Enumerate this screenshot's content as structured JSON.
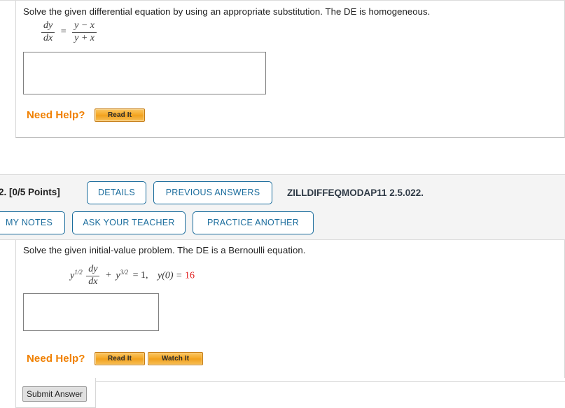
{
  "problem_1": {
    "prompt": "Solve the given differential equation by using an appropriate substitution. The DE is homogeneous.",
    "equation": {
      "lhs_num": "dy",
      "lhs_den": "dx",
      "equals": "=",
      "rhs_num": "y − x",
      "rhs_den": "y + x"
    },
    "answer_value": "",
    "need_help_label": "Need Help?",
    "read_it_label": "Read It"
  },
  "problem_2": {
    "number": "2.  [0/5 Points]",
    "assignment_code": "ZILLDIFFEQMODAP11 2.5.022.",
    "buttons": [
      {
        "id": "details",
        "label": "DETAILS"
      },
      {
        "id": "previous-answers",
        "label": "PREVIOUS ANSWERS"
      },
      {
        "id": "my-notes",
        "label": "MY NOTES"
      },
      {
        "id": "ask-your-teacher",
        "label": "ASK YOUR TEACHER"
      },
      {
        "id": "practice-another",
        "label": "PRACTICE ANOTHER"
      }
    ],
    "prompt": "Solve the given initial-value problem. The DE is a Bernoulli equation.",
    "equation": {
      "y1": "y",
      "exp1": "1/2",
      "frac_num": "dy",
      "frac_den": "dx",
      "plus": "+",
      "y2": "y",
      "exp2": "3/2",
      "equals": "= 1,",
      "initial_condition": "y(0) =",
      "initial_value": "16"
    },
    "answer_value": "",
    "need_help_label": "Need Help?",
    "read_it_label": "Read It",
    "watch_it_label": "Watch It"
  },
  "footer": {
    "submit_label": "Submit Answer"
  },
  "colors": {
    "link_blue": "#1a6c9c",
    "help_orange": "#f08000",
    "button_orange": "#f5a623",
    "initial_value_red": "#e01b1b",
    "header_band": "#f4f4f4"
  }
}
